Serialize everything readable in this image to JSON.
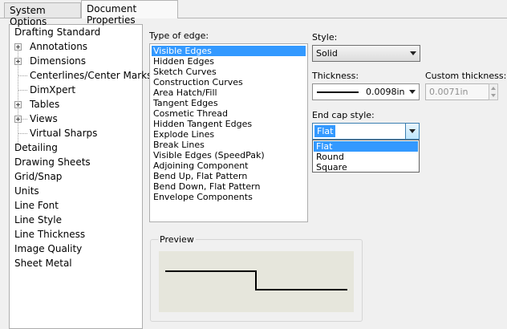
{
  "tabs": [
    {
      "label": "System Options"
    },
    {
      "label": "Document Properties"
    }
  ],
  "tree": {
    "items": [
      {
        "label": "Drafting Standard"
      },
      {
        "label": "Annotations"
      },
      {
        "label": "Dimensions"
      },
      {
        "label": "Centerlines/Center Marks"
      },
      {
        "label": "DimXpert"
      },
      {
        "label": "Tables"
      },
      {
        "label": "Views"
      },
      {
        "label": "Virtual Sharps"
      },
      {
        "label": "Detailing"
      },
      {
        "label": "Drawing Sheets"
      },
      {
        "label": "Grid/Snap"
      },
      {
        "label": "Units"
      },
      {
        "label": "Line Font"
      },
      {
        "label": "Line Style"
      },
      {
        "label": "Line Thickness"
      },
      {
        "label": "Image Quality"
      },
      {
        "label": "Sheet Metal"
      }
    ]
  },
  "type_of_edge": {
    "label": "Type of edge:",
    "items": [
      "Visible Edges",
      "Hidden Edges",
      "Sketch Curves",
      "Construction Curves",
      "Area Hatch/Fill",
      "Tangent Edges",
      "Cosmetic Thread",
      "Hidden Tangent Edges",
      "Explode Lines",
      "Break Lines",
      "Visible Edges (SpeedPak)",
      "Adjoining Component",
      "Bend Up, Flat Pattern",
      "Bend Down, Flat Pattern",
      "Envelope Components"
    ],
    "selected": "Visible Edges"
  },
  "style": {
    "label": "Style:",
    "value": "Solid"
  },
  "thickness": {
    "label": "Thickness:",
    "value": "0.0098in"
  },
  "custom_thickness": {
    "label": "Custom thickness:",
    "value": "0.0071in"
  },
  "end_cap": {
    "label": "End cap style:",
    "value": "Flat",
    "options": [
      "Flat",
      "Round",
      "Square"
    ]
  },
  "preview": {
    "label": "Preview"
  },
  "colors": {
    "selection": "#3399ff",
    "preview_bg": "#e6e6dc"
  }
}
